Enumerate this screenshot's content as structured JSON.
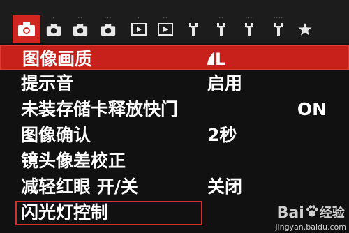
{
  "tabs": [
    {
      "icon": "camera-icon",
      "dots": "",
      "active": true
    },
    {
      "icon": "camera-icon",
      "dots": "·",
      "active": false
    },
    {
      "icon": "camera-icon",
      "dots": "··",
      "active": false
    },
    {
      "icon": "camera-icon",
      "dots": "···",
      "active": false
    },
    {
      "icon": "playback-icon",
      "dots": "·",
      "active": false
    },
    {
      "icon": "playback-icon",
      "dots": "··",
      "active": false
    },
    {
      "icon": "wrench-icon",
      "dots": "·",
      "active": false
    },
    {
      "icon": "wrench-icon",
      "dots": "··",
      "active": false
    },
    {
      "icon": "wrench-icon",
      "dots": "···",
      "active": false
    },
    {
      "icon": "wrench-icon",
      "dots": "····",
      "active": false
    },
    {
      "icon": "star-icon",
      "dots": "",
      "active": false
    }
  ],
  "menu": {
    "items": [
      {
        "label": "图像画质",
        "value": "L",
        "value_icon": "quality-fine-icon",
        "selected": true
      },
      {
        "label": "提示音",
        "value": "启用"
      },
      {
        "label": "未装存储卡释放快门",
        "value": "ON"
      },
      {
        "label": "图像确认",
        "value": "2秒"
      },
      {
        "label": "镜头像差校正",
        "value": ""
      },
      {
        "label": "减轻红眼 开/关",
        "value": "关闭"
      },
      {
        "label": "闪光灯控制",
        "value": "",
        "outlined": true
      }
    ]
  },
  "watermark": {
    "brand": "Bai",
    "brand_suffix": "经验",
    "url": "jingyan.baidu.com"
  },
  "colors": {
    "accent": "#c8201a",
    "outline": "#d6302a",
    "background": "#111111"
  }
}
